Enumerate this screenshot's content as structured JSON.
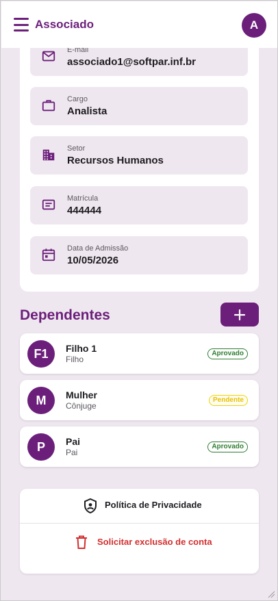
{
  "appbar": {
    "title": "Associado",
    "avatar_letter": "A"
  },
  "fields": [
    {
      "label": "E-mail",
      "value": "associado1@softpar.inf.br",
      "icon": "mail-icon"
    },
    {
      "label": "Cargo",
      "value": "Analista",
      "icon": "briefcase-icon"
    },
    {
      "label": "Setor",
      "value": "Recursos Humanos",
      "icon": "building-icon"
    },
    {
      "label": "Matrícula",
      "value": "444444",
      "icon": "id-card-icon"
    },
    {
      "label": "Data de Admissão",
      "value": "10/05/2026",
      "icon": "calendar-icon"
    }
  ],
  "dependents": {
    "title": "Dependentes",
    "items": [
      {
        "initials": "F1",
        "name": "Filho 1",
        "relation": "Filho",
        "status": "Aprovado"
      },
      {
        "initials": "M",
        "name": "Mulher",
        "relation": "Cônjuge",
        "status": "Pendente"
      },
      {
        "initials": "P",
        "name": "Pai",
        "relation": "Pai",
        "status": "Aprovado"
      }
    ]
  },
  "actions": {
    "privacy_label": "Política de Privacidade",
    "delete_label": "Solicitar exclusão de conta"
  },
  "colors": {
    "primary": "#6b1f7a",
    "background": "#efe7ef",
    "approved": "#2e7d32",
    "pending": "#f2d200",
    "danger": "#d32f2f"
  }
}
